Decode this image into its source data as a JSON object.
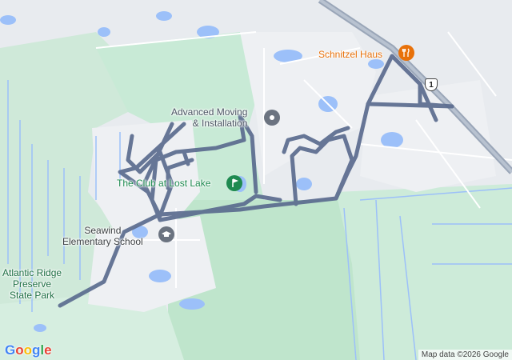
{
  "map": {
    "labels": {
      "atlantic_ridge": "Atlantic Ridge\nPreserve\nState Park",
      "club_lost_lake": "The Club at Lost Lake",
      "seawind_school": "Seawind\nElementary School",
      "advanced_moving": "Advanced Moving\n& Installation",
      "schnitzel_haus": "Schnitzel Haus"
    },
    "highway_shield": "1",
    "attribution": "Map data ©2026 Google",
    "logo": "Google",
    "icons": {
      "club": "golf-icon",
      "school": "school-icon",
      "moving": "pin-icon",
      "restaurant": "restaurant-icon"
    },
    "colors": {
      "land": "#e8ebef",
      "park": "#c8ead6",
      "water": "#9cc0f9",
      "route": "#5b6c8f",
      "road_major": "#9aa6b8"
    }
  }
}
